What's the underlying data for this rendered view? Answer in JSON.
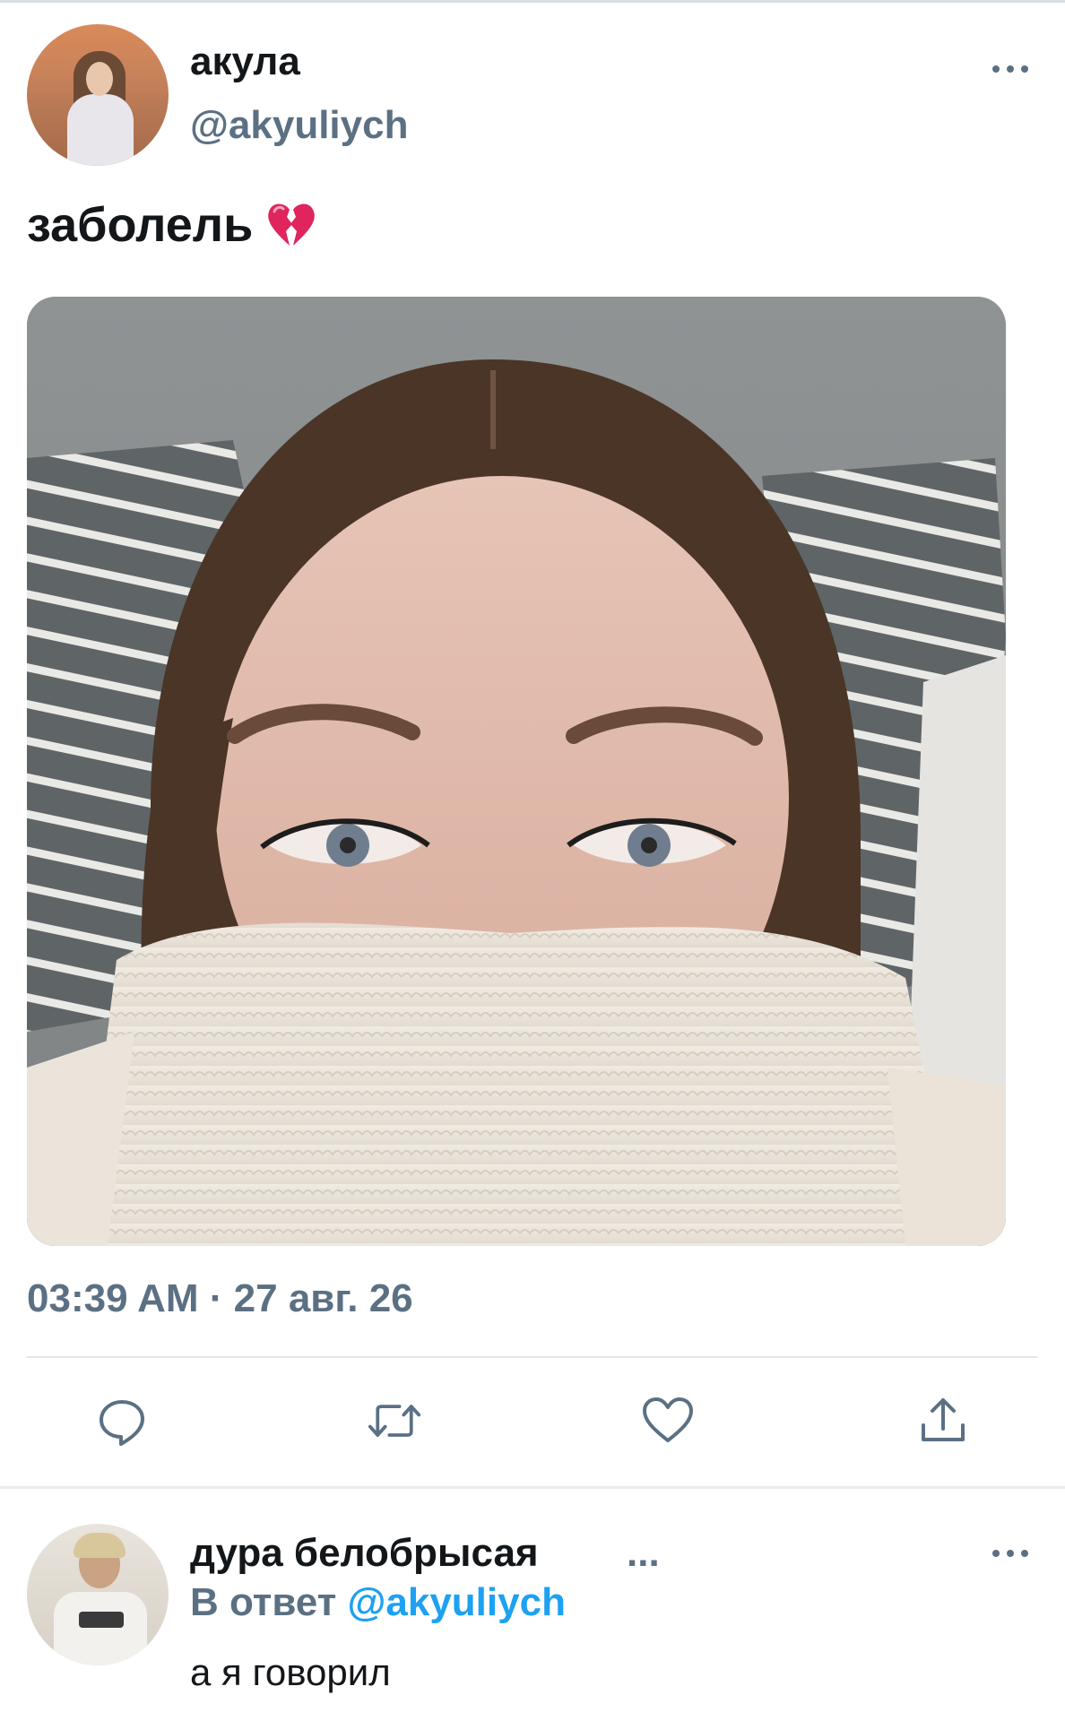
{
  "tweet": {
    "author_name": "акула",
    "author_handle": "@akyuliych",
    "text": "заболель",
    "emoji": "broken-heart-emoji",
    "timestamp": "03:39 AM · 27 авг. 26",
    "photo_alt": "photo"
  },
  "actions": {
    "reply_icon": "reply-icon",
    "retweet_icon": "retweet-icon",
    "like_icon": "heart-icon",
    "share_icon": "share-icon"
  },
  "reply": {
    "author_name": "дура белобрысая",
    "name_ellipsis": "...",
    "in_reply_prefix": "В ответ",
    "in_reply_handle": "@akyuliych",
    "text": "а я говорил"
  },
  "colors": {
    "primary_text": "#14171a",
    "secondary_text": "#5b7083",
    "accent": "#1da1f2",
    "divider": "#e1e8ed"
  }
}
